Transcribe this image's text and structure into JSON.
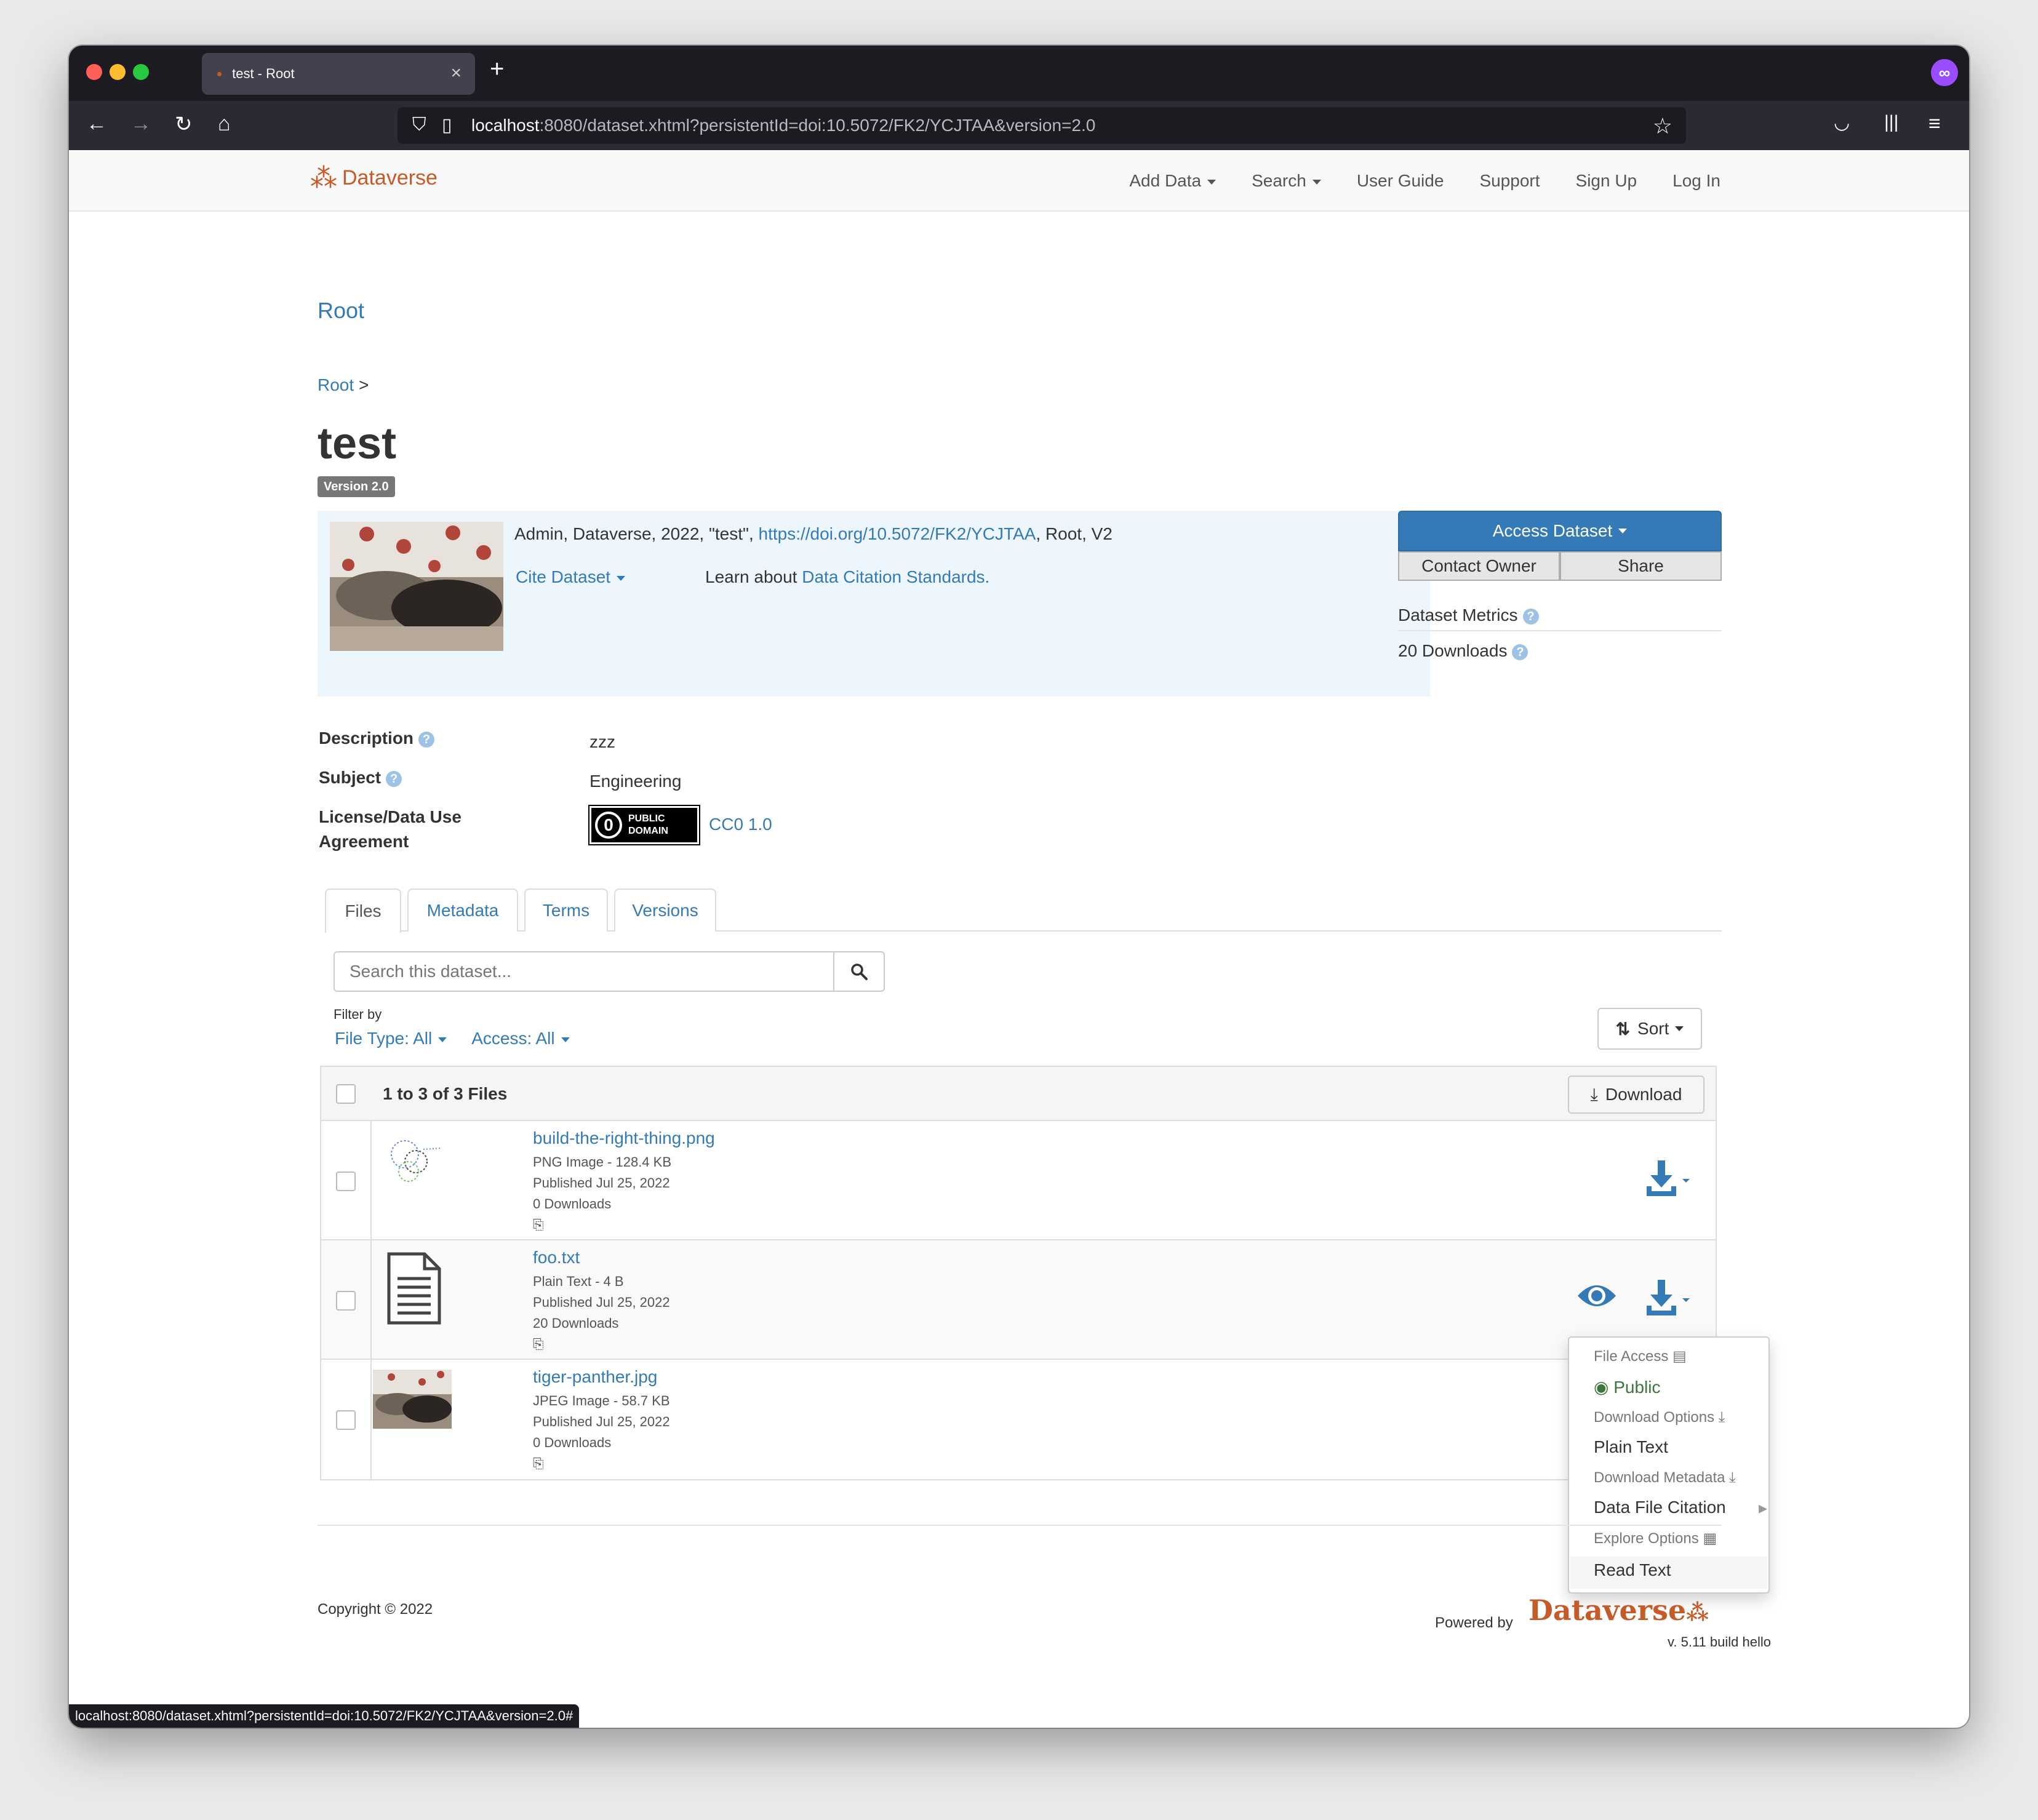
{
  "browser": {
    "tab_title": "test - Root",
    "url_host": "localhost",
    "url_rest": ":8080/dataset.xhtml?persistentId=doi:10.5072/FK2/YCJTAA&version=2.0",
    "status_url": "localhost:8080/dataset.xhtml?persistentId=doi:10.5072/FK2/YCJTAA&version=2.0#"
  },
  "nav": {
    "brand": "Dataverse",
    "items": [
      "Add Data",
      "Search",
      "User Guide",
      "Support",
      "Sign Up",
      "Log In"
    ]
  },
  "page": {
    "dataverse_title": "Root",
    "breadcrumb": "Root",
    "breadcrumb_sep": ">",
    "dataset_title": "test",
    "version_badge": "Version 2.0"
  },
  "citation": {
    "text_prefix": "Admin, Dataverse, 2022, \"test\", ",
    "doi_link": "https://doi.org/10.5072/FK2/YCJTAA",
    "text_suffix": ", Root, V2",
    "cite_button": "Cite Dataset",
    "learn_prefix": "Learn about ",
    "learn_link": "Data Citation Standards."
  },
  "sidebar": {
    "access_button": "Access Dataset",
    "contact_button": "Contact Owner",
    "share_button": "Share",
    "metrics_label": "Dataset Metrics",
    "downloads": "20 Downloads"
  },
  "metadata": {
    "description_label": "Description",
    "description_value": "zzz",
    "subject_label": "Subject",
    "subject_value": "Engineering",
    "license_label_1": "License/Data Use",
    "license_label_2": "Agreement",
    "license_badge_1": "PUBLIC",
    "license_badge_2": "DOMAIN",
    "license_link": "CC0 1.0"
  },
  "tabs": [
    "Files",
    "Metadata",
    "Terms",
    "Versions"
  ],
  "files_panel": {
    "search_placeholder": "Search this dataset...",
    "filter_by": "Filter by",
    "filter_type": "File Type: All",
    "filter_access": "Access: All",
    "sort": "Sort",
    "count": "1 to 3 of 3 Files",
    "download": "Download"
  },
  "files": [
    {
      "name": "build-the-right-thing.png",
      "type": "PNG Image - 128.4 KB",
      "published": "Published Jul 25, 2022",
      "downloads": "0 Downloads"
    },
    {
      "name": "foo.txt",
      "type": "Plain Text - 4 B",
      "published": "Published Jul 25, 2022",
      "downloads": "20 Downloads"
    },
    {
      "name": "tiger-panther.jpg",
      "type": "JPEG Image - 58.7 KB",
      "published": "Published Jul 25, 2022",
      "downloads": "0 Downloads"
    }
  ],
  "dropdown": {
    "file_access": "File Access",
    "public": "Public",
    "download_options": "Download Options",
    "plain_text": "Plain Text",
    "download_metadata": "Download Metadata",
    "data_file_citation": "Data File Citation",
    "explore_options": "Explore Options",
    "read_text": "Read Text"
  },
  "footer": {
    "copyright": "Copyright © 2022",
    "powered_by": "Powered by",
    "logo_text": "Dataverse",
    "version": "v. 5.11 build hello"
  },
  "colors": {
    "link": "#337ab7",
    "brand": "#c55b28",
    "public": "#3c763d"
  }
}
